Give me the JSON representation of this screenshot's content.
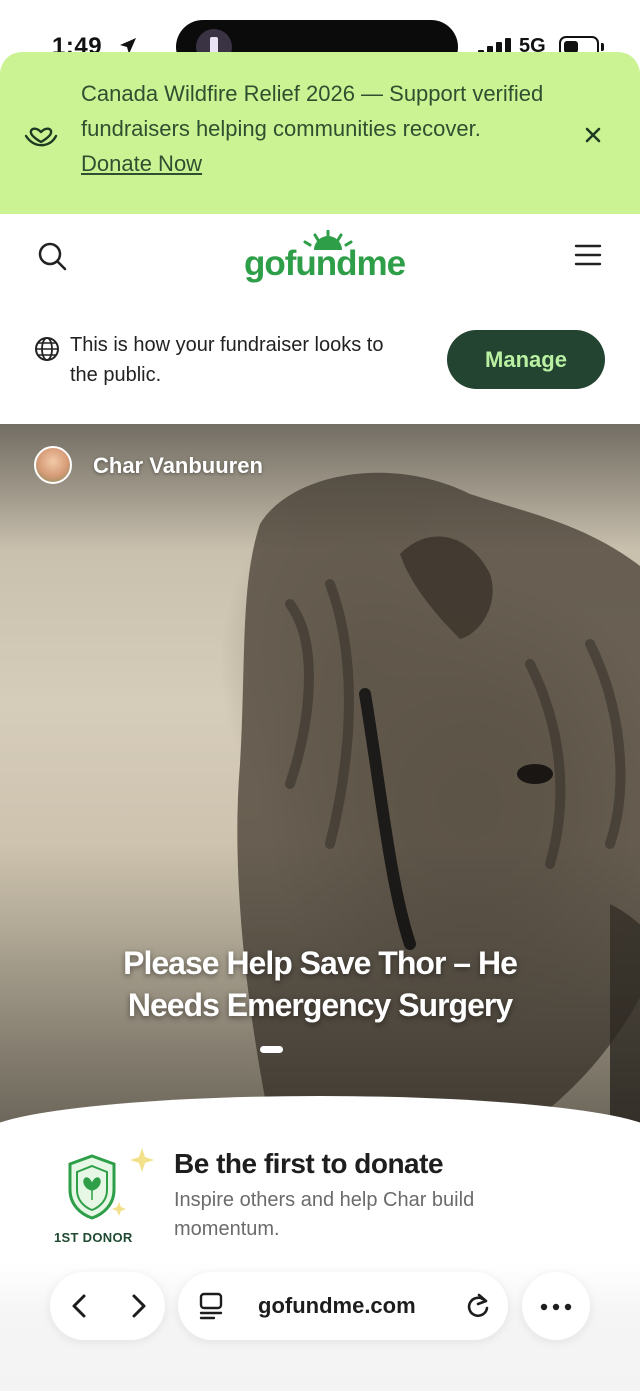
{
  "status_bar": {
    "time": "1:49",
    "network": "5G"
  },
  "banner": {
    "text": "Canada Wildfire Relief 2026 — Support verified fundraisers helping communities recover.",
    "link_label": "Donate Now"
  },
  "header": {
    "logo_text": "gofundme"
  },
  "notice": {
    "text": "This is how your fundraiser looks to the public.",
    "manage_label": "Manage"
  },
  "hero": {
    "author_name": "Char Vanbuuren",
    "title": "Please Help Save Thor – He Needs Emergency Surgery"
  },
  "first_donor": {
    "badge_label": "1ST DONOR",
    "title": "Be the first to donate",
    "subtitle": "Inspire others and help Char build momentum."
  },
  "browser": {
    "url": "gofundme.com"
  },
  "colors": {
    "banner_bg": "#ccf393",
    "brand_green": "#2e9f48",
    "manage_bg": "#234430",
    "manage_text": "#b9f0a2"
  }
}
